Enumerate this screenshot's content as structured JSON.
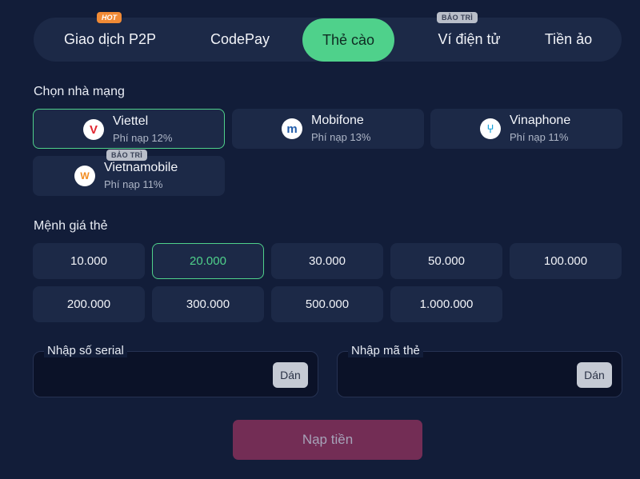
{
  "tabs": [
    {
      "label": "Giao dịch P2P",
      "badge": "HOT"
    },
    {
      "label": "CodePay"
    },
    {
      "label": "Thẻ cào",
      "active": true
    },
    {
      "label": "Ví điện tử",
      "badge": "BẢO TRÌ"
    },
    {
      "label": "Tiền ảo"
    }
  ],
  "carrier_section": {
    "title": "Chọn nhà mạng"
  },
  "carriers": [
    {
      "name": "Viettel",
      "fee": "Phí nạp 12%",
      "selected": true,
      "icon": "viettel-logo",
      "glyph": "V",
      "color": "#e1252f"
    },
    {
      "name": "Mobifone",
      "fee": "Phí nạp 13%",
      "icon": "mobifone-logo",
      "glyph": "m",
      "color": "#1f5aa8"
    },
    {
      "name": "Vinaphone",
      "fee": "Phí nạp 11%",
      "icon": "vinaphone-logo",
      "glyph": "⑂",
      "color": "#1aa3d9"
    },
    {
      "name": "Vietnamobile",
      "fee": "Phí nạp 11%",
      "badge": "BẢO TRÌ",
      "icon": "vietnamobile-logo",
      "glyph": "W",
      "color": "#f28b1e"
    }
  ],
  "denomination_section": {
    "title": "Mệnh giá thẻ"
  },
  "denominations": [
    "10.000",
    "20.000",
    "30.000",
    "50.000",
    "100.000",
    "200.000",
    "300.000",
    "500.000",
    "1.000.000"
  ],
  "selected_denomination": "20.000",
  "serial_field": {
    "label": "Nhập số serial",
    "value": "",
    "paste_label": "Dán"
  },
  "code_field": {
    "label": "Nhập mã thẻ",
    "value": "",
    "paste_label": "Dán"
  },
  "submit_label": "Nạp tiền",
  "colors": {
    "background": "#121d39",
    "card": "#1c2947",
    "accent": "#4fd18b",
    "hot": "#f08a35",
    "submit": "#732d55"
  }
}
